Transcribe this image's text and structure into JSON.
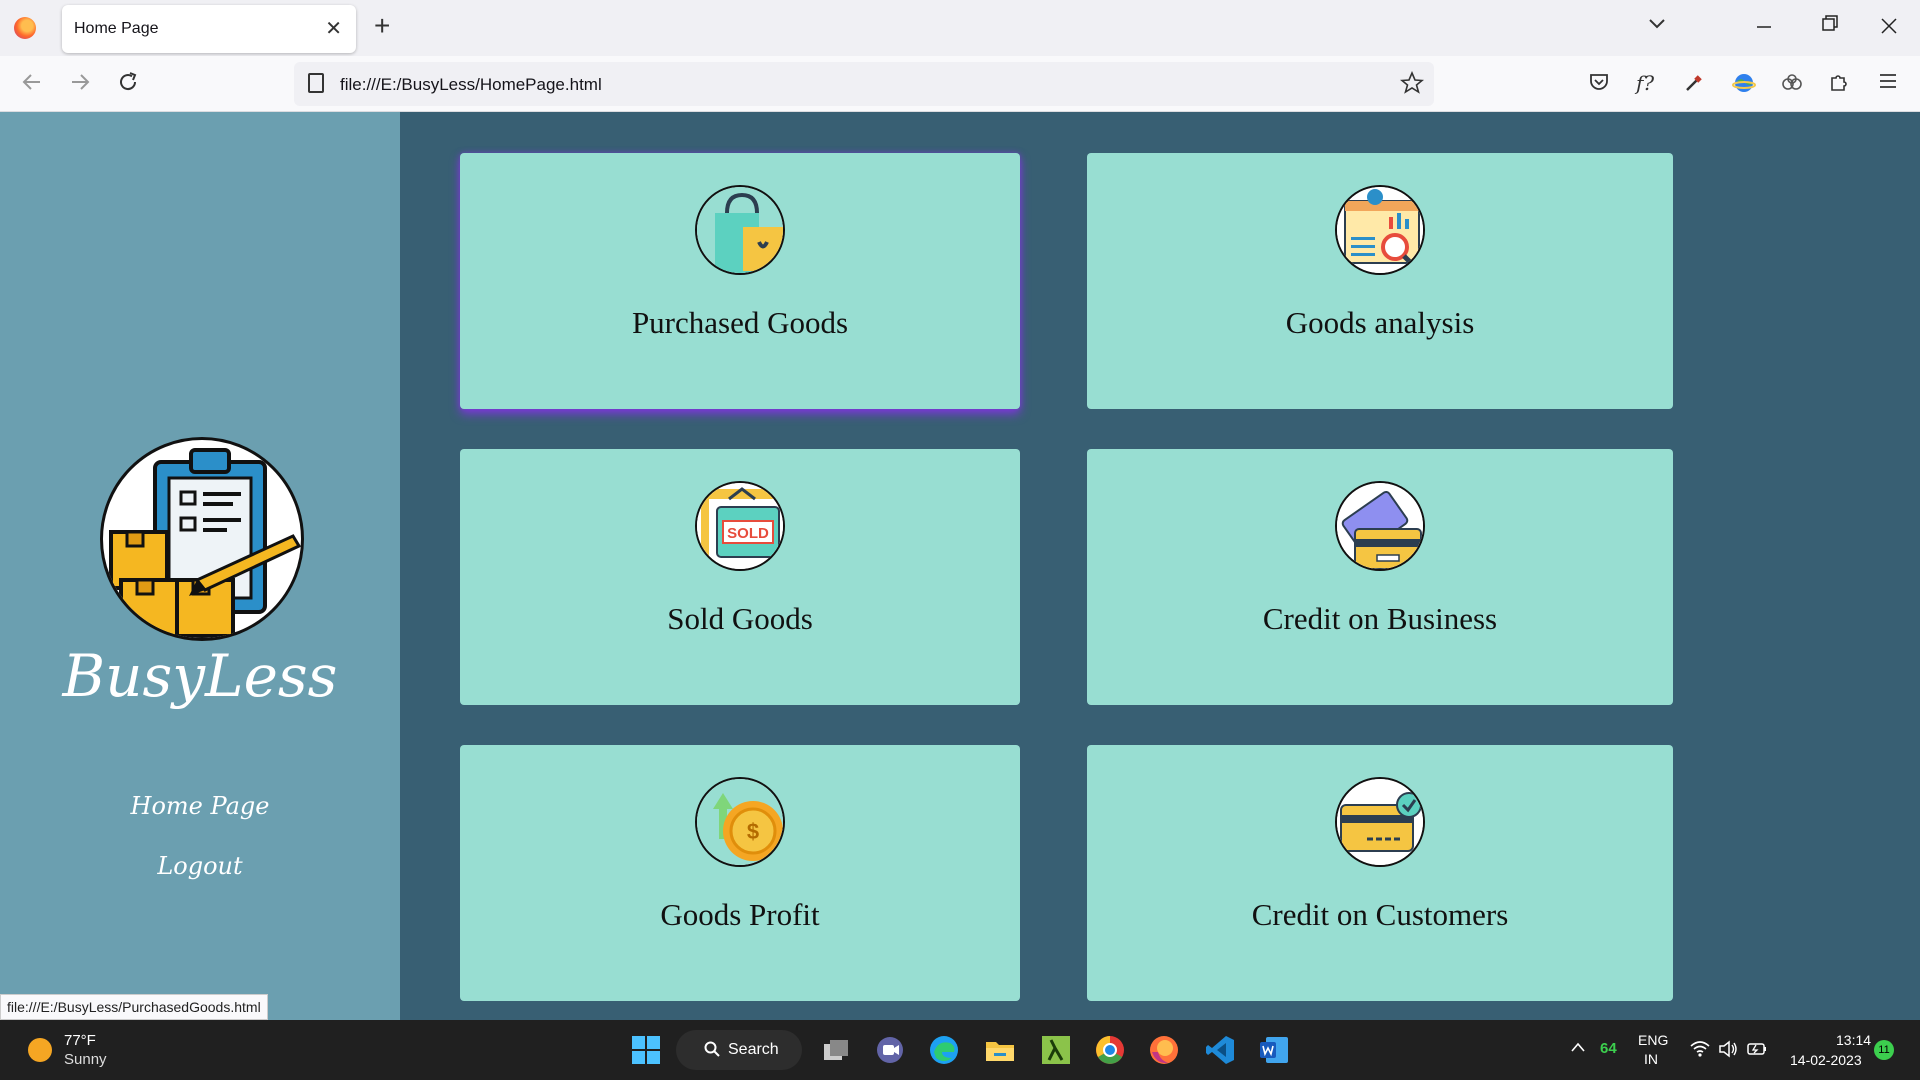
{
  "browser": {
    "tab_title": "Home Page",
    "tab_close": "✕",
    "new_tab": "+",
    "url": "file:///E:/BusyLess/HomePage.html",
    "status_url": "file:///E:/BusyLess/PurchasedGoods.html",
    "extension_label": "f?"
  },
  "sidebar": {
    "brand": "BusyLess",
    "links": [
      {
        "label": "Home Page"
      },
      {
        "label": "Logout"
      }
    ]
  },
  "cards": [
    {
      "label": "Purchased Goods",
      "icon": "shopping-bag-icon"
    },
    {
      "label": "Goods analysis",
      "icon": "analytics-icon"
    },
    {
      "label": "Sold Goods",
      "icon": "sold-sign-icon",
      "icon_text": "SOLD"
    },
    {
      "label": "Credit on Business",
      "icon": "credit-card-icon"
    },
    {
      "label": "Goods Profit",
      "icon": "coin-icon",
      "icon_text": "$"
    },
    {
      "label": "Credit on Customers",
      "icon": "card-check-icon"
    }
  ],
  "taskbar": {
    "temperature": "77°F",
    "weather": "Sunny",
    "search_label": "Search",
    "tray_count": "64",
    "language": "ENG",
    "region": "IN",
    "time": "13:14",
    "date": "14-02-2023",
    "notifications": "11"
  },
  "colors": {
    "page_bg": "#385f73",
    "sidebar_bg": "#6b9fb0",
    "card_bg": "#98ded2",
    "active_glow": "#7b38d8"
  }
}
